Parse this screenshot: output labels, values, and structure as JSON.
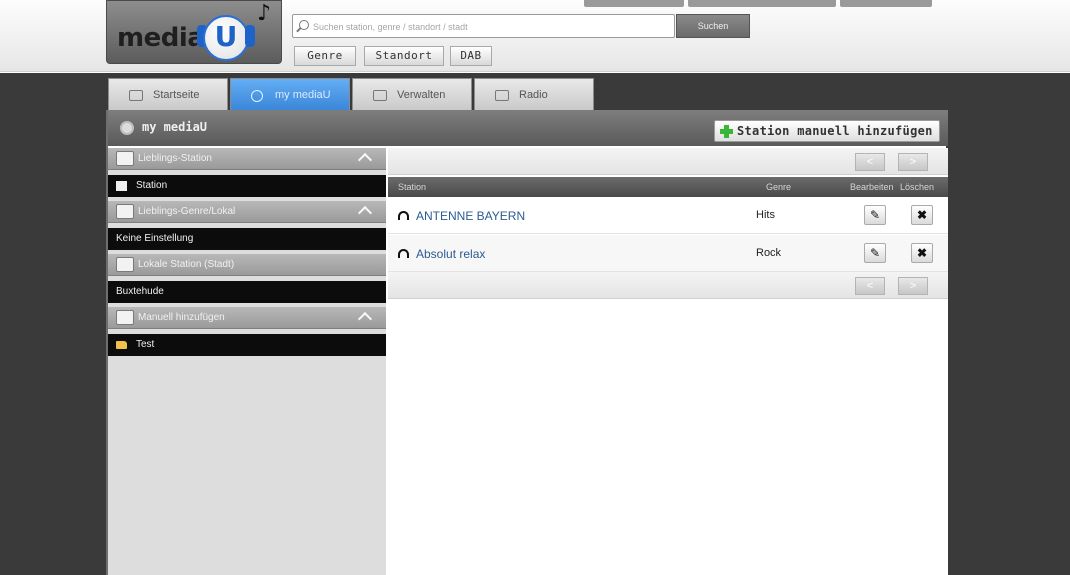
{
  "header": {
    "logo_word": "media",
    "logo_letter": "U",
    "search": {
      "placeholder": "Suchen station, genre / standort / stadt"
    },
    "search_button": "Suchen",
    "filters": [
      "Genre",
      "Standort",
      "DAB"
    ]
  },
  "tabs": [
    {
      "label": "Startseite",
      "active": false
    },
    {
      "label": "my mediaU",
      "active": true
    },
    {
      "label": "Verwalten",
      "active": false
    },
    {
      "label": "Radio",
      "active": false
    }
  ],
  "panel": {
    "title": "my mediaU",
    "add_button": "Station manuell hinzufügen"
  },
  "sidebar": {
    "sections": [
      {
        "title": "Lieblings-Station",
        "collapsible": true,
        "item": "Station",
        "item_icon": "station-icon"
      },
      {
        "title": "Lieblings-Genre/Lokal",
        "collapsible": true,
        "item": "Keine Einstellung",
        "item_icon": ""
      },
      {
        "title": "Lokale Station (Stadt)",
        "collapsible": false,
        "item": "Buxtehude",
        "item_icon": ""
      },
      {
        "title": "Manuell hinzufügen",
        "collapsible": true,
        "item": "Test",
        "item_icon": "folder-icon"
      }
    ]
  },
  "pager": {
    "prev": "<",
    "next": ">"
  },
  "table": {
    "columns": [
      "Station",
      "Genre",
      "Bearbeiten",
      "Löschen"
    ],
    "rows": [
      {
        "station": "ANTENNE BAYERN",
        "genre": "Hits"
      },
      {
        "station": "Absolut relax",
        "genre": "Rock"
      }
    ],
    "edit_glyph": "✎",
    "delete_glyph": "✖"
  },
  "colors": {
    "active_tab": "#3a86d8",
    "link": "#2c5a92",
    "add_icon": "#3ab53a"
  }
}
